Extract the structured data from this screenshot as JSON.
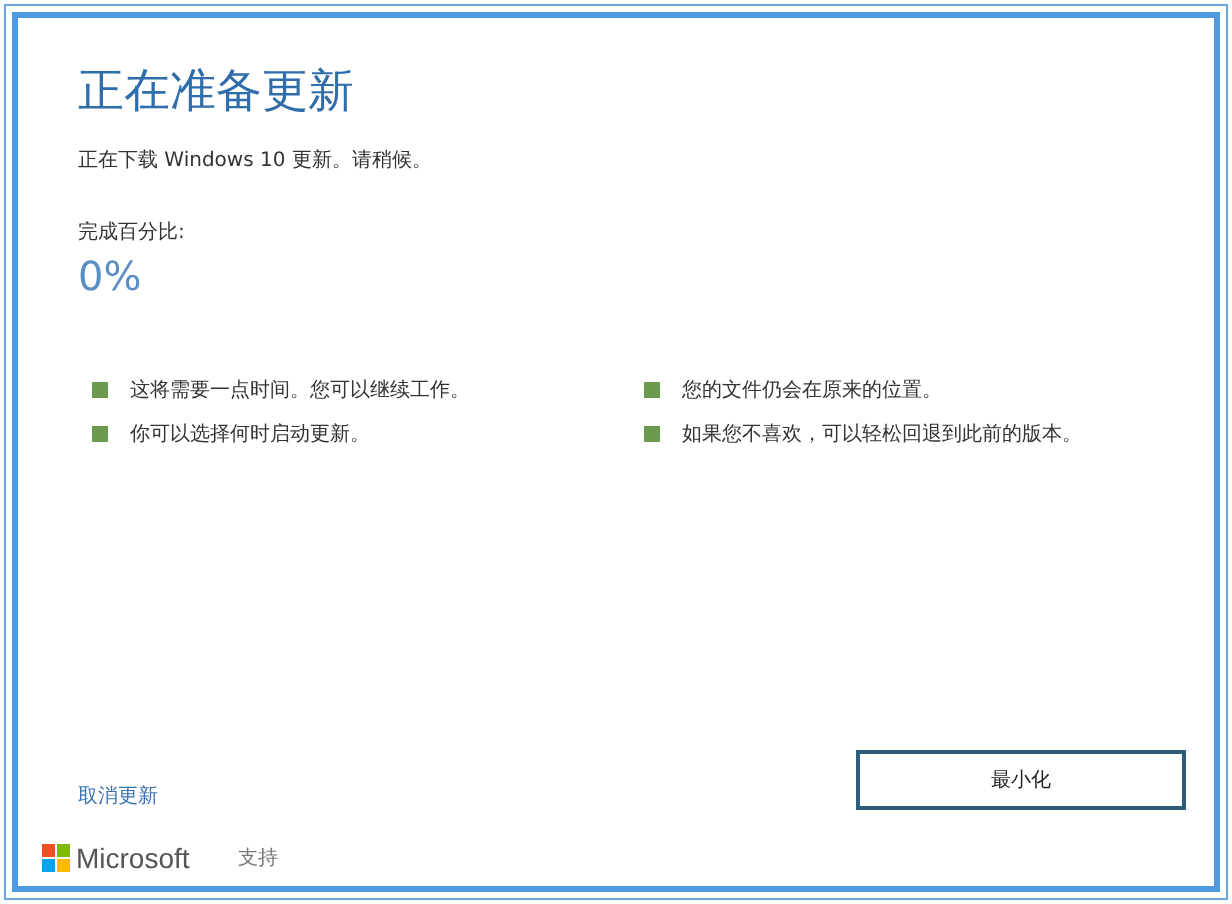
{
  "title": "正在准备更新",
  "subtitle": "正在下载 Windows 10 更新。请稍候。",
  "progress": {
    "label": "完成百分比:",
    "value": "0%"
  },
  "notes": [
    {
      "text": "这将需要一点时间。您可以继续工作。"
    },
    {
      "text": "您的文件仍会在原来的位置。"
    },
    {
      "text": "你可以选择何时启动更新。"
    },
    {
      "text": "如果您不喜欢，可以轻松回退到此前的版本。"
    }
  ],
  "cancel_link": "取消更新",
  "minimize_button": "最小化",
  "footer": {
    "brand": "Microsoft",
    "support_link": "支持"
  }
}
